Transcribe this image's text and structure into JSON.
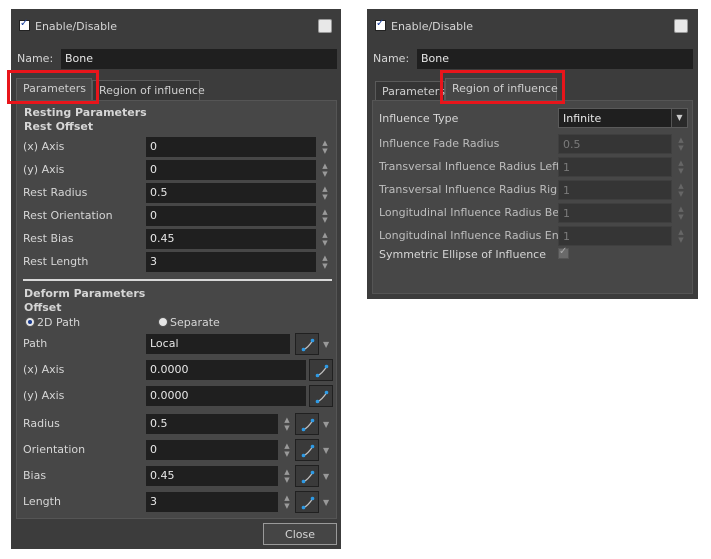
{
  "left_panel": {
    "enable_label": "Enable/Disable",
    "name_label": "Name:",
    "name_value": "Bone",
    "tabs": [
      "Parameters",
      "Region of influence"
    ],
    "resting": {
      "title": "Resting Parameters",
      "subtitle": "Rest Offset",
      "rows": [
        {
          "label": "(x) Axis",
          "value": "0"
        },
        {
          "label": "(y) Axis",
          "value": "0"
        },
        {
          "label": "Rest Radius",
          "value": "0.5"
        },
        {
          "label": "Rest Orientation",
          "value": "0"
        },
        {
          "label": "Rest Bias",
          "value": "0.45"
        },
        {
          "label": "Rest Length",
          "value": "3"
        }
      ]
    },
    "deform": {
      "title": "Deform Parameters",
      "subtitle": "Offset",
      "radio_2d": "2D Path",
      "radio_separate": "Separate",
      "path_label": "Path",
      "path_value": "Local",
      "xaxis_label": "(x) Axis",
      "xaxis_value": "0.0000",
      "yaxis_label": "(y) Axis",
      "yaxis_value": "0.0000",
      "rows": [
        {
          "label": "Radius",
          "value": "0.5"
        },
        {
          "label": "Orientation",
          "value": "0"
        },
        {
          "label": "Bias",
          "value": "0.45"
        },
        {
          "label": "Length",
          "value": "3"
        }
      ]
    },
    "close_label": "Close"
  },
  "right_panel": {
    "enable_label": "Enable/Disable",
    "name_label": "Name:",
    "name_value": "Bone",
    "tabs": [
      "Parameters",
      "Region of influence"
    ],
    "influence_type_label": "Influence Type",
    "influence_type_value": "Infinite",
    "rows": [
      {
        "label": "Influence Fade Radius",
        "value": "0.5"
      },
      {
        "label": "Transversal Influence Radius Left",
        "value": "1"
      },
      {
        "label": "Transversal Influence Radius Right",
        "value": "1"
      },
      {
        "label": "Longitudinal Influence Radius Begin",
        "value": "1"
      },
      {
        "label": "Longitudinal Influence Radius End",
        "value": "1"
      }
    ],
    "symmetric_label": "Symmetric Ellipse of Influence"
  },
  "colors": {
    "panel_bg": "#3c3c3c",
    "field_bg": "#1f1f1f",
    "highlight": "#e8151b"
  },
  "icons": {
    "function_curve": "function-curve-icon",
    "spinner": "spinner-arrows-icon",
    "dropdown": "chevron-down-icon"
  }
}
